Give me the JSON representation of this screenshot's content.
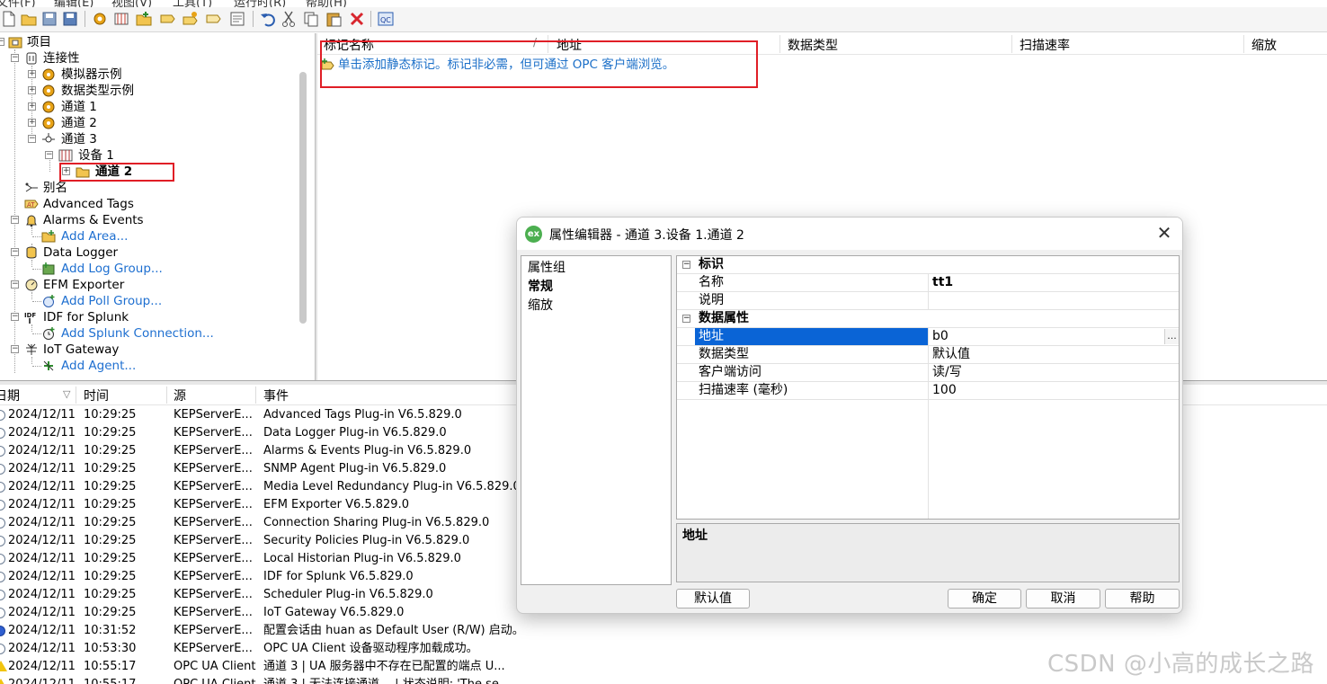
{
  "menu": [
    "文件(F)",
    "编辑(E)",
    "视图(V)",
    "工具(T)",
    "运行时(R)",
    "帮助(H)"
  ],
  "toolbar_icons": [
    "new-icon",
    "open-icon",
    "save-icon",
    "save-as-icon",
    "new-channel-icon",
    "new-device-icon",
    "new-group-icon",
    "new-tag-icon",
    "bulk-tags-icon",
    "duplicate-icon",
    "properties-icon",
    "undo-icon",
    "cut-icon",
    "copy-icon",
    "paste-icon",
    "delete-icon",
    "qc-client-icon"
  ],
  "tree": {
    "project": "项目",
    "connectivity": "连接性",
    "simulator_examples": "模拟器示例",
    "data_type_examples": "数据类型示例",
    "channel1": "通道 1",
    "channel2": "通道 2",
    "channel3": "通道 3",
    "device1": "设备 1",
    "group": "通道 2",
    "aliases": "别名",
    "advanced_tags": "Advanced Tags",
    "alarms_events": "Alarms & Events",
    "add_area": "Add Area...",
    "data_logger": "Data Logger",
    "add_log_group": "Add Log Group...",
    "efm_exporter": "EFM Exporter",
    "add_poll_group": "Add Poll Group...",
    "idf_splunk": "IDF for Splunk",
    "add_splunk": "Add Splunk Connection...",
    "iot_gateway": "IoT Gateway",
    "add_agent": "Add Agent..."
  },
  "tag_list": {
    "columns": [
      "标记名称",
      "地址",
      "数据类型",
      "扫描速率",
      "缩放"
    ],
    "hint": "单击添加静态标记。标记非必需，但可通过 OPC 客户端浏览。"
  },
  "log": {
    "columns": [
      "日期",
      "时间",
      "源",
      "事件"
    ],
    "rows": [
      {
        "date": "2024/12/11",
        "time": "10:29:25",
        "source": "KEPServerE...",
        "event": "Advanced Tags Plug-in V6.5.829.0",
        "kind": "info"
      },
      {
        "date": "2024/12/11",
        "time": "10:29:25",
        "source": "KEPServerE...",
        "event": "Data Logger Plug-in V6.5.829.0",
        "kind": "info"
      },
      {
        "date": "2024/12/11",
        "time": "10:29:25",
        "source": "KEPServerE...",
        "event": "Alarms & Events Plug-in V6.5.829.0",
        "kind": "info"
      },
      {
        "date": "2024/12/11",
        "time": "10:29:25",
        "source": "KEPServerE...",
        "event": "SNMP Agent Plug-in V6.5.829.0",
        "kind": "info"
      },
      {
        "date": "2024/12/11",
        "time": "10:29:25",
        "source": "KEPServerE...",
        "event": "Media Level Redundancy Plug-in V6.5.829.0",
        "kind": "info"
      },
      {
        "date": "2024/12/11",
        "time": "10:29:25",
        "source": "KEPServerE...",
        "event": "EFM Exporter V6.5.829.0",
        "kind": "info"
      },
      {
        "date": "2024/12/11",
        "time": "10:29:25",
        "source": "KEPServerE...",
        "event": "Connection Sharing Plug-in V6.5.829.0",
        "kind": "info"
      },
      {
        "date": "2024/12/11",
        "time": "10:29:25",
        "source": "KEPServerE...",
        "event": "Security Policies Plug-in V6.5.829.0",
        "kind": "info"
      },
      {
        "date": "2024/12/11",
        "time": "10:29:25",
        "source": "KEPServerE...",
        "event": "Local Historian Plug-in V6.5.829.0",
        "kind": "info"
      },
      {
        "date": "2024/12/11",
        "time": "10:29:25",
        "source": "KEPServerE...",
        "event": "IDF for Splunk V6.5.829.0",
        "kind": "info"
      },
      {
        "date": "2024/12/11",
        "time": "10:29:25",
        "source": "KEPServerE...",
        "event": "Scheduler Plug-in V6.5.829.0",
        "kind": "info"
      },
      {
        "date": "2024/12/11",
        "time": "10:29:25",
        "source": "KEPServerE...",
        "event": "IoT Gateway V6.5.829.0",
        "kind": "info"
      },
      {
        "date": "2024/12/11",
        "time": "10:31:52",
        "source": "KEPServerE...",
        "event": "配置会话由 huan as Default User (R/W) 启动。",
        "kind": "security"
      },
      {
        "date": "2024/12/11",
        "time": "10:53:30",
        "source": "KEPServerE...",
        "event": "OPC UA Client 设备驱动程序加载成功。",
        "kind": "info"
      },
      {
        "date": "2024/12/11",
        "time": "10:55:17",
        "source": "OPC UA Client",
        "event": "通道 3 | UA 服务器中不存在已配置的端点 U...",
        "kind": "warning"
      },
      {
        "date": "2024/12/11",
        "time": "10:55:17",
        "source": "OPC UA Client",
        "event": "通道 3 | 无法连接通道。 | 状态说明: 'The se...",
        "kind": "warning"
      }
    ]
  },
  "dialog": {
    "title": "属性编辑器 - 通道 3.设备 1.通道 2",
    "groups_header": "属性组",
    "groups": [
      "常规",
      "缩放"
    ],
    "categories": [
      {
        "name": "标识",
        "props": [
          {
            "name": "名称",
            "value": "tt1"
          },
          {
            "name": "说明",
            "value": ""
          }
        ]
      },
      {
        "name": "数据属性",
        "props": [
          {
            "name": "地址",
            "value": "b0"
          },
          {
            "name": "数据类型",
            "value": "默认值"
          },
          {
            "name": "客户端访问",
            "value": "读/写"
          },
          {
            "name": "扫描速率 (毫秒)",
            "value": "100"
          }
        ]
      }
    ],
    "description_title": "地址",
    "buttons": {
      "defaults": "默认值",
      "ok": "确定",
      "cancel": "取消",
      "help": "帮助"
    }
  },
  "watermark": "CSDN @小高的成长之路",
  "colors": {
    "link": "#1e6fd0",
    "selection": "#0a64d6",
    "annotation": "#e01e26"
  }
}
